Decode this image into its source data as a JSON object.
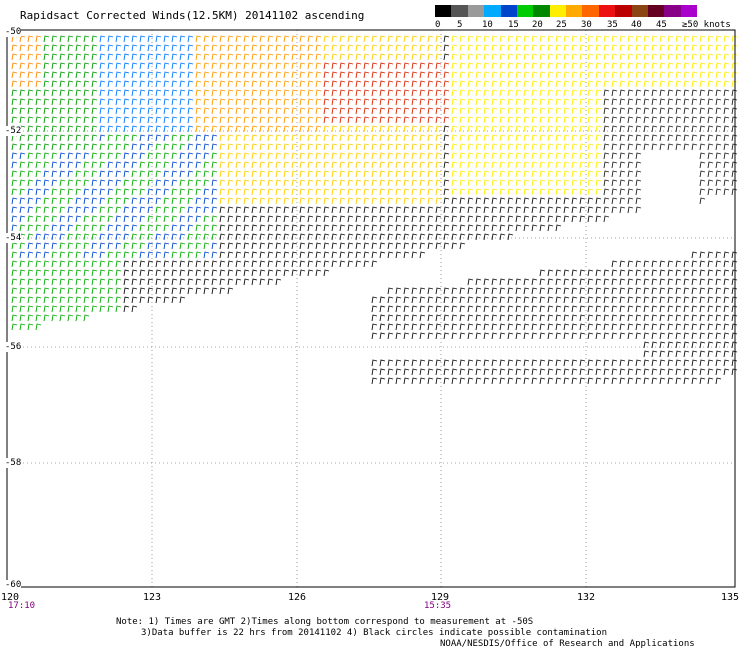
{
  "title": "Rapidsact Corrected Winds(12.5KM) 20141102 ascending",
  "legend": {
    "colors": [
      "#000000",
      "#555555",
      "#9a9a9a",
      "#00aaff",
      "#0044cc",
      "#00cc00",
      "#008800",
      "#ffee00",
      "#ffaa00",
      "#ff6600",
      "#ee1111",
      "#bb0000",
      "#8b4513",
      "#660022",
      "#880088",
      "#aa00cc"
    ],
    "labels": [
      "0",
      "5",
      "10",
      "15",
      "20",
      "25",
      "30",
      "35",
      "40",
      "45",
      "≥50 knots"
    ]
  },
  "axes": {
    "x_ticks": [
      "120",
      "123",
      "126",
      "129",
      "132",
      "135"
    ],
    "y_ticks": [
      "-50",
      "-52",
      "-54",
      "-56",
      "-58",
      "-60"
    ],
    "time_labels": [
      "17:10",
      "15:35"
    ]
  },
  "notes": {
    "line1": "Note: 1) Times are GMT 2)Times along bottom correspond to measurement at -50S",
    "line2": "3)Data buffer is 22 hrs from 20141102 4) Black circles indicate possible contamination",
    "credit": "NOAA/NESDIS/Office of Research and Applications"
  }
}
